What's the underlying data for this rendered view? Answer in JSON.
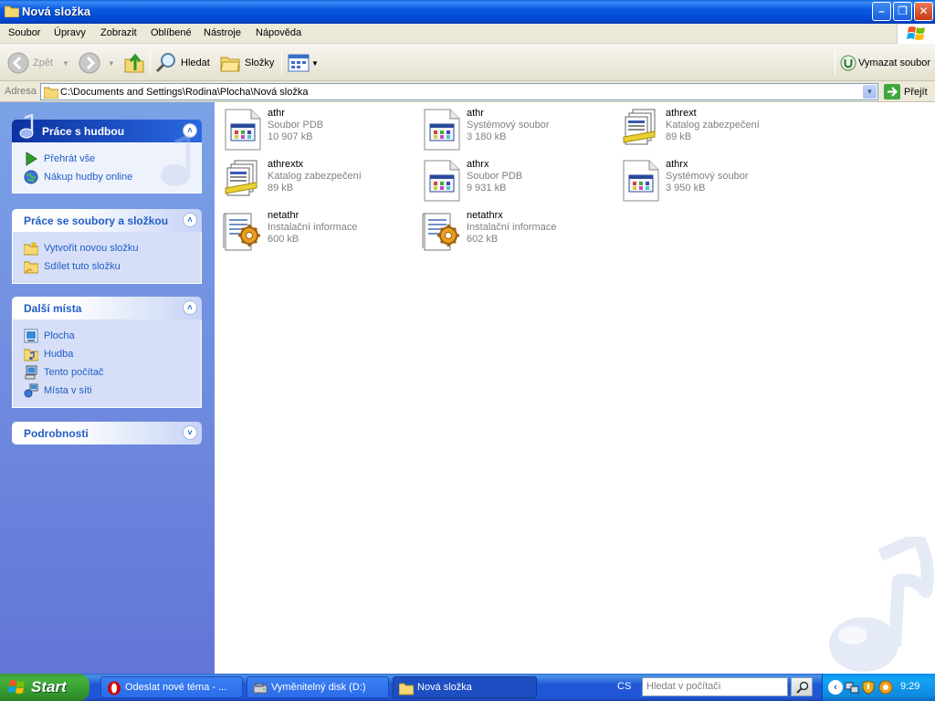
{
  "window": {
    "title": "Nová složka",
    "minimize": "0",
    "maximize": "1",
    "close": "r"
  },
  "menu": [
    "Soubor",
    "Úpravy",
    "Zobrazit",
    "Oblíbené",
    "Nástroje",
    "Nápověda"
  ],
  "toolbar": {
    "back_label": "Zpět",
    "search_label": "Hledat",
    "folders_label": "Složky",
    "delete_file_label": "Vymazat soubor"
  },
  "address": {
    "label": "Adresa",
    "path": "C:\\Documents and Settings\\Rodina\\Plocha\\Nová složka",
    "go_label": "Přejít"
  },
  "panels": {
    "music": {
      "title": "Práce s hudbou",
      "items": [
        {
          "label": "Přehrát vše",
          "icon": "play-icon"
        },
        {
          "label": "Nákup hudby online",
          "icon": "globe-icon"
        }
      ]
    },
    "files": {
      "title": "Práce se soubory a složkou",
      "items": [
        {
          "label": "Vytvořit novou složku",
          "icon": "new-folder-icon"
        },
        {
          "label": "Sdílet tuto složku",
          "icon": "share-folder-icon"
        }
      ]
    },
    "places": {
      "title": "Další místa",
      "items": [
        {
          "label": "Plocha",
          "icon": "desktop-icon"
        },
        {
          "label": "Hudba",
          "icon": "music-folder-icon"
        },
        {
          "label": "Tento počítač",
          "icon": "computer-icon"
        },
        {
          "label": "Místa v síti",
          "icon": "network-icon"
        }
      ]
    },
    "details": {
      "title": "Podrobnosti"
    }
  },
  "files": [
    {
      "name": "athr",
      "type": "Soubor PDB",
      "size": "10 907 kB",
      "icon": "system-file-icon"
    },
    {
      "name": "athr",
      "type": "Systémový soubor",
      "size": "3 180 kB",
      "icon": "system-file-icon"
    },
    {
      "name": "athrext",
      "type": "Katalog zabezpečení",
      "size": "89 kB",
      "icon": "catalog-icon"
    },
    {
      "name": "athrextx",
      "type": "Katalog zabezpečení",
      "size": "89 kB",
      "icon": "catalog-icon"
    },
    {
      "name": "athrx",
      "type": "Soubor PDB",
      "size": "9 931 kB",
      "icon": "system-file-icon"
    },
    {
      "name": "athrx",
      "type": "Systémový soubor",
      "size": "3 950 kB",
      "icon": "system-file-icon"
    },
    {
      "name": "netathr",
      "type": "Instalační informace",
      "size": "600 kB",
      "icon": "setup-info-icon"
    },
    {
      "name": "netathrx",
      "type": "Instalační informace",
      "size": "602 kB",
      "icon": "setup-info-icon"
    }
  ],
  "taskbar": {
    "start": "Start",
    "tasks": [
      {
        "label": "Odeslat nové téma - ...",
        "icon": "opera-icon"
      },
      {
        "label": "Vyměnitelný disk (D:)",
        "icon": "drive-icon"
      },
      {
        "label": "Nová složka",
        "icon": "folder-icon"
      }
    ],
    "language": "CS",
    "search_placeholder": "Hledat v počítači",
    "clock": "9:29"
  }
}
